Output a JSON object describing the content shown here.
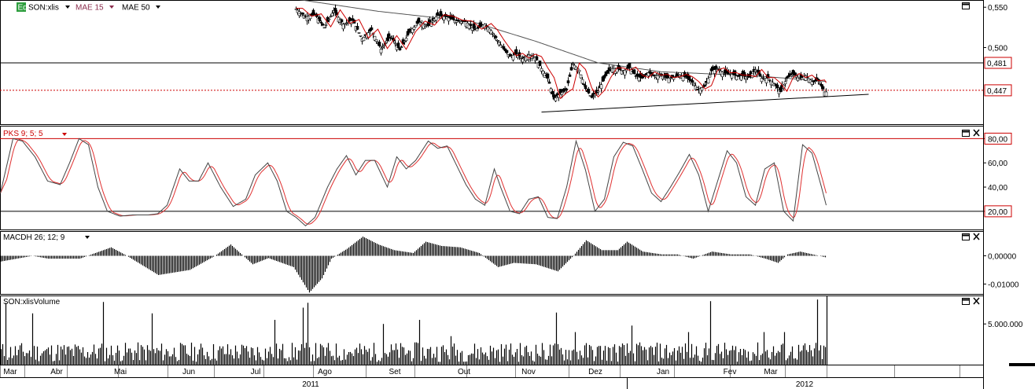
{
  "colors": {
    "price_up": "#ffffff",
    "price_down": "#000000",
    "mae15": "#cc0000",
    "mae50": "#555555",
    "stoch_k": "#444444",
    "stoch_d": "#e03030",
    "ref_line_red": "#cc0000",
    "ref_line_black": "#000000",
    "badge_green": "#2e9e3e",
    "badge_red_border": "#cc0000"
  },
  "header": {
    "symbol_label": "SON:xlis",
    "mae15_label": "MAE 15",
    "mae50_label": "MAE 50",
    "stoch_label": "PKS 9; 5; 5",
    "macd_label": "MACDH 26; 12; 9",
    "volume_label": "SON:xlisVolume",
    "badge_text": "Eq"
  },
  "chart_data": [
    {
      "type": "candlestick",
      "panel": "price",
      "yticks": [
        "0,550",
        "0,500"
      ],
      "ytick_values": [
        0.55,
        0.5
      ],
      "ylim": [
        0.405,
        0.558
      ],
      "hlines": [
        {
          "value": 0.481,
          "label": "0,481",
          "style": "solid",
          "color": "#000000"
        },
        {
          "value": 0.447,
          "label": "0,447",
          "style": "dotted",
          "color": "#cc0000"
        }
      ],
      "series": [
        {
          "name": "MAE 15"
        },
        {
          "name": "MAE 50"
        }
      ],
      "anchors": [
        [
          188,
          0.548
        ],
        [
          194,
          0.538
        ],
        [
          200,
          0.541
        ],
        [
          206,
          0.525
        ],
        [
          212,
          0.546
        ],
        [
          218,
          0.529
        ],
        [
          224,
          0.534
        ],
        [
          230,
          0.511
        ],
        [
          236,
          0.522
        ],
        [
          242,
          0.498
        ],
        [
          248,
          0.514
        ],
        [
          254,
          0.497
        ],
        [
          260,
          0.519
        ],
        [
          266,
          0.532
        ],
        [
          272,
          0.527
        ],
        [
          278,
          0.54
        ],
        [
          284,
          0.538
        ],
        [
          290,
          0.533
        ],
        [
          296,
          0.532
        ],
        [
          302,
          0.522
        ],
        [
          308,
          0.529
        ],
        [
          312,
          0.521
        ],
        [
          316,
          0.509
        ],
        [
          320,
          0.498
        ],
        [
          324,
          0.489
        ],
        [
          328,
          0.492
        ],
        [
          332,
          0.486
        ],
        [
          336,
          0.491
        ],
        [
          340,
          0.488
        ],
        [
          344,
          0.474
        ],
        [
          348,
          0.462
        ],
        [
          352,
          0.436
        ],
        [
          356,
          0.443
        ],
        [
          360,
          0.448
        ],
        [
          364,
          0.48
        ],
        [
          368,
          0.472
        ],
        [
          372,
          0.449
        ],
        [
          376,
          0.438
        ],
        [
          380,
          0.446
        ],
        [
          384,
          0.462
        ],
        [
          388,
          0.474
        ],
        [
          392,
          0.474
        ],
        [
          396,
          0.471
        ],
        [
          400,
          0.475
        ],
        [
          404,
          0.465
        ],
        [
          408,
          0.462
        ],
        [
          412,
          0.469
        ],
        [
          416,
          0.465
        ],
        [
          420,
          0.466
        ],
        [
          424,
          0.462
        ],
        [
          428,
          0.463
        ],
        [
          432,
          0.466
        ],
        [
          436,
          0.463
        ],
        [
          440,
          0.457
        ],
        [
          444,
          0.448
        ],
        [
          448,
          0.452
        ],
        [
          452,
          0.471
        ],
        [
          456,
          0.474
        ],
        [
          460,
          0.468
        ],
        [
          464,
          0.468
        ],
        [
          468,
          0.465
        ],
        [
          472,
          0.465
        ],
        [
          476,
          0.463
        ],
        [
          480,
          0.472
        ],
        [
          484,
          0.462
        ],
        [
          488,
          0.462
        ],
        [
          492,
          0.455
        ],
        [
          496,
          0.445
        ],
        [
          500,
          0.462
        ],
        [
          504,
          0.467
        ],
        [
          508,
          0.462
        ],
        [
          512,
          0.465
        ],
        [
          516,
          0.458
        ],
        [
          520,
          0.459
        ],
        [
          524,
          0.445
        ]
      ],
      "xrange_index": [
        188,
        525
      ],
      "trendline": {
        "from": [
          344,
          0.42
        ],
        "to": [
          552,
          0.442
        ]
      },
      "mae15_offset": 0.004,
      "mae50": [
        [
          188,
          0.56
        ],
        [
          240,
          0.545
        ],
        [
          300,
          0.532
        ],
        [
          340,
          0.508
        ],
        [
          380,
          0.481
        ],
        [
          420,
          0.47
        ],
        [
          480,
          0.465
        ],
        [
          525,
          0.458
        ]
      ]
    },
    {
      "type": "line",
      "panel": "stochastic",
      "yticks": [
        "80,00",
        "60,00",
        "40,00",
        "20,00"
      ],
      "ytick_values": [
        80,
        60,
        40,
        20
      ],
      "ylim": [
        5,
        90
      ],
      "hlines": [
        {
          "value": 80,
          "label": "80,00",
          "color": "#cc0000"
        },
        {
          "value": 20,
          "label": "20,00",
          "color": "#000000"
        }
      ],
      "series": [
        {
          "name": "PKS 9; 5; 5"
        }
      ],
      "k_anchors": [
        [
          0,
          35
        ],
        [
          8,
          80
        ],
        [
          14,
          78
        ],
        [
          22,
          65
        ],
        [
          30,
          45
        ],
        [
          38,
          42
        ],
        [
          44,
          60
        ],
        [
          50,
          80
        ],
        [
          56,
          75
        ],
        [
          62,
          40
        ],
        [
          68,
          20
        ],
        [
          76,
          16
        ],
        [
          84,
          17
        ],
        [
          94,
          17
        ],
        [
          100,
          18
        ],
        [
          106,
          25
        ],
        [
          114,
          55
        ],
        [
          120,
          45
        ],
        [
          126,
          45
        ],
        [
          132,
          60
        ],
        [
          140,
          40
        ],
        [
          148,
          24
        ],
        [
          156,
          30
        ],
        [
          162,
          50
        ],
        [
          170,
          60
        ],
        [
          176,
          45
        ],
        [
          182,
          20
        ],
        [
          188,
          15
        ],
        [
          194,
          8
        ],
        [
          200,
          15
        ],
        [
          208,
          40
        ],
        [
          214,
          55
        ],
        [
          220,
          66
        ],
        [
          226,
          50
        ],
        [
          232,
          62
        ],
        [
          238,
          62
        ],
        [
          246,
          40
        ],
        [
          252,
          65
        ],
        [
          258,
          55
        ],
        [
          264,
          62
        ],
        [
          272,
          78
        ],
        [
          278,
          72
        ],
        [
          284,
          74
        ],
        [
          290,
          58
        ],
        [
          296,
          42
        ],
        [
          302,
          30
        ],
        [
          308,
          25
        ],
        [
          314,
          55
        ],
        [
          318,
          40
        ],
        [
          324,
          20
        ],
        [
          330,
          18
        ],
        [
          336,
          30
        ],
        [
          342,
          32
        ],
        [
          348,
          15
        ],
        [
          354,
          14
        ],
        [
          360,
          40
        ],
        [
          366,
          78
        ],
        [
          372,
          54
        ],
        [
          378,
          20
        ],
        [
          384,
          30
        ],
        [
          390,
          65
        ],
        [
          396,
          77
        ],
        [
          402,
          74
        ],
        [
          408,
          55
        ],
        [
          414,
          35
        ],
        [
          420,
          28
        ],
        [
          426,
          40
        ],
        [
          432,
          53
        ],
        [
          438,
          67
        ],
        [
          444,
          50
        ],
        [
          450,
          20
        ],
        [
          456,
          45
        ],
        [
          462,
          70
        ],
        [
          468,
          60
        ],
        [
          474,
          32
        ],
        [
          480,
          25
        ],
        [
          486,
          55
        ],
        [
          492,
          60
        ],
        [
          498,
          20
        ],
        [
          504,
          12
        ],
        [
          510,
          75
        ],
        [
          516,
          68
        ],
        [
          522,
          40
        ],
        [
          525,
          25
        ]
      ]
    },
    {
      "type": "bar",
      "panel": "macd_histogram",
      "yticks": [
        "0,00000",
        "-0,01000"
      ],
      "ytick_values": [
        0,
        -0.01
      ],
      "ylim": [
        -0.0135,
        0.0085
      ],
      "series": [
        {
          "name": "MACDH 26; 12; 9"
        }
      ],
      "anchors": [
        [
          0,
          -0.002
        ],
        [
          20,
          0.0
        ],
        [
          30,
          -0.001
        ],
        [
          50,
          -0.001
        ],
        [
          70,
          0.003
        ],
        [
          80,
          0.0
        ],
        [
          100,
          -0.0068
        ],
        [
          120,
          -0.005
        ],
        [
          136,
          0.0
        ],
        [
          146,
          0.004
        ],
        [
          160,
          -0.003
        ],
        [
          170,
          -0.0008
        ],
        [
          186,
          -0.004
        ],
        [
          196,
          -0.013
        ],
        [
          204,
          -0.008
        ],
        [
          210,
          -0.001
        ],
        [
          220,
          0.0025
        ],
        [
          230,
          0.0068
        ],
        [
          240,
          0.004
        ],
        [
          250,
          0.002
        ],
        [
          262,
          0.001
        ],
        [
          270,
          0.005
        ],
        [
          280,
          0.0035
        ],
        [
          292,
          0.003
        ],
        [
          304,
          0.001
        ],
        [
          316,
          -0.004
        ],
        [
          326,
          -0.0025
        ],
        [
          340,
          -0.003
        ],
        [
          354,
          -0.0055
        ],
        [
          364,
          0.0001
        ],
        [
          372,
          0.0055
        ],
        [
          382,
          0.002
        ],
        [
          392,
          0.002
        ],
        [
          398,
          0.005
        ],
        [
          408,
          0.0015
        ],
        [
          420,
          0.0005
        ],
        [
          430,
          0.0005
        ],
        [
          440,
          -0.001
        ],
        [
          452,
          0.0015
        ],
        [
          464,
          0.0005
        ],
        [
          476,
          0.0005
        ],
        [
          486,
          -0.001
        ],
        [
          494,
          -0.0025
        ],
        [
          500,
          0.0005
        ],
        [
          508,
          0.0015
        ],
        [
          516,
          0.0005
        ],
        [
          524,
          -0.0005
        ]
      ]
    },
    {
      "type": "bar",
      "panel": "volume",
      "yticks": [
        "5.000.000"
      ],
      "ytick_values": [
        5000000
      ],
      "ylim": [
        0,
        8400000
      ],
      "series": [
        {
          "name": "SON:xlisVolume"
        }
      ],
      "spikes": [
        [
          3,
          7600000
        ],
        [
          20,
          6300000
        ],
        [
          65,
          7700000
        ],
        [
          96,
          6300000
        ],
        [
          174,
          5500000
        ],
        [
          192,
          7000000
        ],
        [
          195,
          7600000
        ],
        [
          243,
          5000000
        ],
        [
          266,
          5500000
        ],
        [
          286,
          3500000
        ],
        [
          353,
          6400000
        ],
        [
          365,
          4000000
        ],
        [
          401,
          4800000
        ],
        [
          437,
          4000000
        ],
        [
          451,
          7800000
        ],
        [
          485,
          4000000
        ],
        [
          498,
          4000000
        ],
        [
          519,
          8000000
        ],
        [
          525,
          8400000
        ]
      ],
      "base": 2200000
    }
  ],
  "xaxis": {
    "months": [
      "Mar",
      "Abr",
      "Mai",
      "Jun",
      "Jul",
      "Ago",
      "Set",
      "Out",
      "Nov",
      "Dez",
      "Jan",
      "Fev",
      "Mar"
    ],
    "years": [
      "2011",
      "2012"
    ]
  }
}
